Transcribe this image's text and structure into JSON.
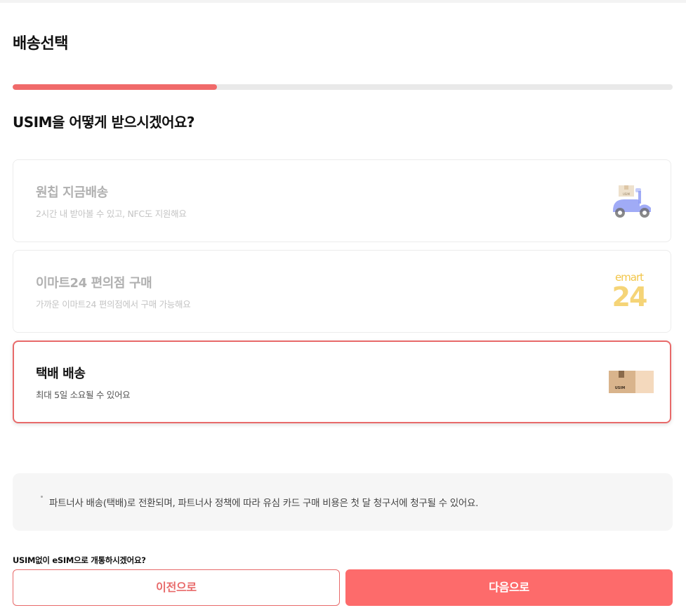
{
  "page": {
    "title": "배송선택",
    "question": "USIM을 어떻게 받으시겠어요?",
    "progress": 0.31
  },
  "options": [
    {
      "title": "원칩 지금배송",
      "description": "2시간 내 받아볼 수 있고, NFC도 지원해요",
      "icon": "scooter-delivery-icon",
      "state": "disabled"
    },
    {
      "title": "이마트24 편의점 구매",
      "description": "가까운 이마트24 편의점에서 구매 가능해요",
      "icon": "emart24-logo",
      "logo_text": "emart",
      "logo_number": "24",
      "state": "disabled"
    },
    {
      "title": "택배 배송",
      "description": "최대 5일 소요될 수 있어요",
      "icon": "usim-box-icon",
      "state": "selected"
    }
  ],
  "notice": {
    "text": "파트너사 배송(택배)로 전환되며, 파트너사 정책에 따라 유심 카드 구매 비용은 첫 달 청구서에 청구될 수 있어요."
  },
  "esim_link": "USIM없이 eSIM으로 개통하시겠어요?",
  "buttons": {
    "prev_label": "이전으로",
    "next_label": "다음으로"
  },
  "icon_labels": {
    "scooter_box": "USIM",
    "box": "USIM"
  },
  "colors": {
    "accent": "#f06a6a",
    "selected_border": "#e86a6a",
    "next_button": "#fd6b6b",
    "emart_logo": "#f2c64a",
    "scooter": "#8f9cf5",
    "box": "#d9b48c"
  }
}
